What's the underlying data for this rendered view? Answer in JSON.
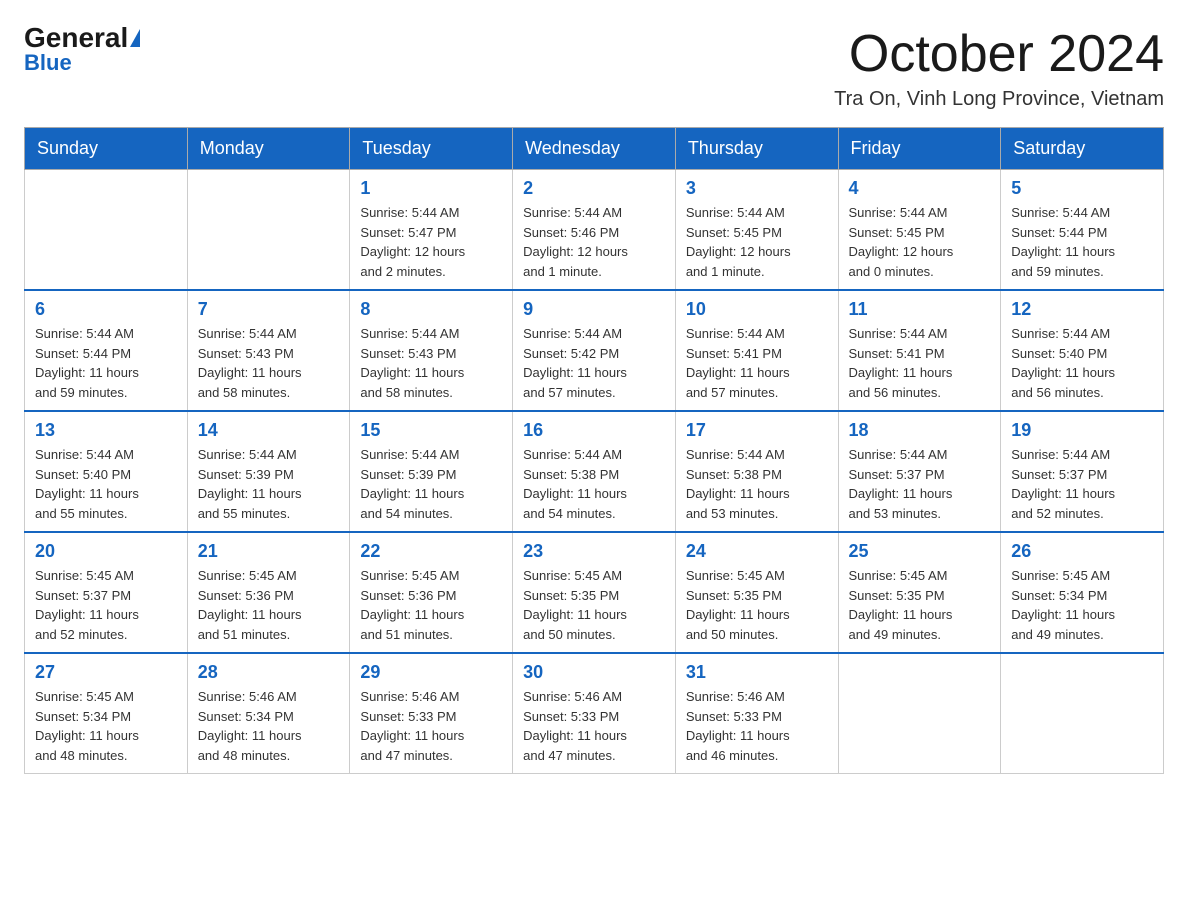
{
  "logo": {
    "general": "General",
    "blue": "Blue"
  },
  "header": {
    "month": "October 2024",
    "location": "Tra On, Vinh Long Province, Vietnam"
  },
  "weekdays": [
    "Sunday",
    "Monday",
    "Tuesday",
    "Wednesday",
    "Thursday",
    "Friday",
    "Saturday"
  ],
  "weeks": [
    [
      {
        "day": "",
        "info": ""
      },
      {
        "day": "",
        "info": ""
      },
      {
        "day": "1",
        "info": "Sunrise: 5:44 AM\nSunset: 5:47 PM\nDaylight: 12 hours\nand 2 minutes."
      },
      {
        "day": "2",
        "info": "Sunrise: 5:44 AM\nSunset: 5:46 PM\nDaylight: 12 hours\nand 1 minute."
      },
      {
        "day": "3",
        "info": "Sunrise: 5:44 AM\nSunset: 5:45 PM\nDaylight: 12 hours\nand 1 minute."
      },
      {
        "day": "4",
        "info": "Sunrise: 5:44 AM\nSunset: 5:45 PM\nDaylight: 12 hours\nand 0 minutes."
      },
      {
        "day": "5",
        "info": "Sunrise: 5:44 AM\nSunset: 5:44 PM\nDaylight: 11 hours\nand 59 minutes."
      }
    ],
    [
      {
        "day": "6",
        "info": "Sunrise: 5:44 AM\nSunset: 5:44 PM\nDaylight: 11 hours\nand 59 minutes."
      },
      {
        "day": "7",
        "info": "Sunrise: 5:44 AM\nSunset: 5:43 PM\nDaylight: 11 hours\nand 58 minutes."
      },
      {
        "day": "8",
        "info": "Sunrise: 5:44 AM\nSunset: 5:43 PM\nDaylight: 11 hours\nand 58 minutes."
      },
      {
        "day": "9",
        "info": "Sunrise: 5:44 AM\nSunset: 5:42 PM\nDaylight: 11 hours\nand 57 minutes."
      },
      {
        "day": "10",
        "info": "Sunrise: 5:44 AM\nSunset: 5:41 PM\nDaylight: 11 hours\nand 57 minutes."
      },
      {
        "day": "11",
        "info": "Sunrise: 5:44 AM\nSunset: 5:41 PM\nDaylight: 11 hours\nand 56 minutes."
      },
      {
        "day": "12",
        "info": "Sunrise: 5:44 AM\nSunset: 5:40 PM\nDaylight: 11 hours\nand 56 minutes."
      }
    ],
    [
      {
        "day": "13",
        "info": "Sunrise: 5:44 AM\nSunset: 5:40 PM\nDaylight: 11 hours\nand 55 minutes."
      },
      {
        "day": "14",
        "info": "Sunrise: 5:44 AM\nSunset: 5:39 PM\nDaylight: 11 hours\nand 55 minutes."
      },
      {
        "day": "15",
        "info": "Sunrise: 5:44 AM\nSunset: 5:39 PM\nDaylight: 11 hours\nand 54 minutes."
      },
      {
        "day": "16",
        "info": "Sunrise: 5:44 AM\nSunset: 5:38 PM\nDaylight: 11 hours\nand 54 minutes."
      },
      {
        "day": "17",
        "info": "Sunrise: 5:44 AM\nSunset: 5:38 PM\nDaylight: 11 hours\nand 53 minutes."
      },
      {
        "day": "18",
        "info": "Sunrise: 5:44 AM\nSunset: 5:37 PM\nDaylight: 11 hours\nand 53 minutes."
      },
      {
        "day": "19",
        "info": "Sunrise: 5:44 AM\nSunset: 5:37 PM\nDaylight: 11 hours\nand 52 minutes."
      }
    ],
    [
      {
        "day": "20",
        "info": "Sunrise: 5:45 AM\nSunset: 5:37 PM\nDaylight: 11 hours\nand 52 minutes."
      },
      {
        "day": "21",
        "info": "Sunrise: 5:45 AM\nSunset: 5:36 PM\nDaylight: 11 hours\nand 51 minutes."
      },
      {
        "day": "22",
        "info": "Sunrise: 5:45 AM\nSunset: 5:36 PM\nDaylight: 11 hours\nand 51 minutes."
      },
      {
        "day": "23",
        "info": "Sunrise: 5:45 AM\nSunset: 5:35 PM\nDaylight: 11 hours\nand 50 minutes."
      },
      {
        "day": "24",
        "info": "Sunrise: 5:45 AM\nSunset: 5:35 PM\nDaylight: 11 hours\nand 50 minutes."
      },
      {
        "day": "25",
        "info": "Sunrise: 5:45 AM\nSunset: 5:35 PM\nDaylight: 11 hours\nand 49 minutes."
      },
      {
        "day": "26",
        "info": "Sunrise: 5:45 AM\nSunset: 5:34 PM\nDaylight: 11 hours\nand 49 minutes."
      }
    ],
    [
      {
        "day": "27",
        "info": "Sunrise: 5:45 AM\nSunset: 5:34 PM\nDaylight: 11 hours\nand 48 minutes."
      },
      {
        "day": "28",
        "info": "Sunrise: 5:46 AM\nSunset: 5:34 PM\nDaylight: 11 hours\nand 48 minutes."
      },
      {
        "day": "29",
        "info": "Sunrise: 5:46 AM\nSunset: 5:33 PM\nDaylight: 11 hours\nand 47 minutes."
      },
      {
        "day": "30",
        "info": "Sunrise: 5:46 AM\nSunset: 5:33 PM\nDaylight: 11 hours\nand 47 minutes."
      },
      {
        "day": "31",
        "info": "Sunrise: 5:46 AM\nSunset: 5:33 PM\nDaylight: 11 hours\nand 46 minutes."
      },
      {
        "day": "",
        "info": ""
      },
      {
        "day": "",
        "info": ""
      }
    ]
  ]
}
